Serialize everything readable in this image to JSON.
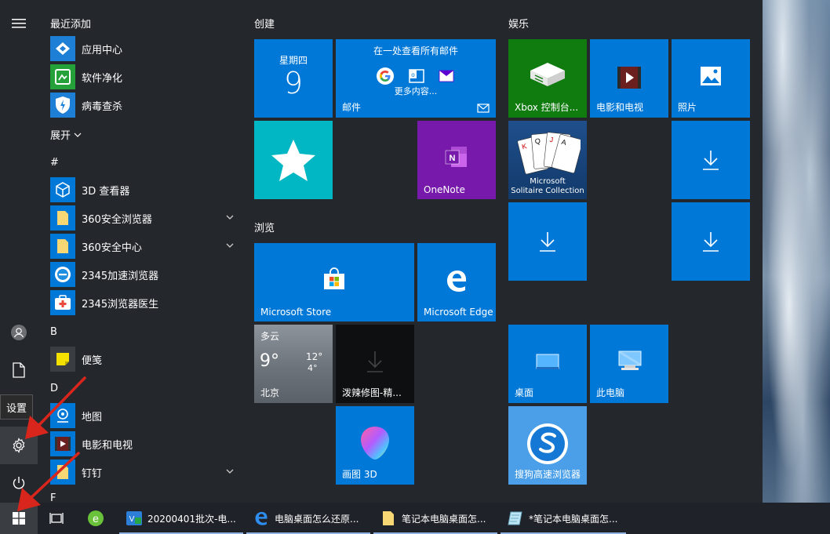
{
  "menu": {
    "recent_header": "最近添加",
    "recent_items": [
      {
        "label": "应用中心",
        "icon": "app-center-icon"
      },
      {
        "label": "软件净化",
        "icon": "software-clean-icon"
      },
      {
        "label": "病毒查杀",
        "icon": "virus-scan-icon"
      }
    ],
    "expand_label": "展开",
    "groups": [
      {
        "letter": "#",
        "items": [
          {
            "label": "3D 查看器",
            "icon": "3d-viewer-icon",
            "chevron": false
          },
          {
            "label": "360安全浏览器",
            "icon": "folder-icon",
            "chevron": true
          },
          {
            "label": "360安全中心",
            "icon": "folder-icon",
            "chevron": true
          },
          {
            "label": "2345加速浏览器",
            "icon": "2345-browser-icon",
            "chevron": false
          },
          {
            "label": "2345浏览器医生",
            "icon": "browser-doctor-icon",
            "chevron": false
          }
        ]
      },
      {
        "letter": "B",
        "items": [
          {
            "label": "便笺",
            "icon": "sticky-notes-icon",
            "chevron": false
          }
        ]
      },
      {
        "letter": "D",
        "items": [
          {
            "label": "地图",
            "icon": "maps-icon",
            "chevron": false
          },
          {
            "label": "电影和电视",
            "icon": "movies-tv-icon",
            "chevron": false
          },
          {
            "label": "钉钉",
            "icon": "folder-icon",
            "chevron": true
          }
        ]
      },
      {
        "letter": "F",
        "items": []
      }
    ],
    "rail_tooltip": "设置"
  },
  "tiles": {
    "section_create": "创建",
    "section_browse": "浏览",
    "section_play": "娱乐",
    "calendar_day": "星期四",
    "calendar_date": "9",
    "mail_heading": "在一处查看所有邮件",
    "mail_more": "更多内容...",
    "mail_label": "邮件",
    "onenote_label": "OneNote",
    "store_label": "Microsoft Store",
    "edge_label": "Microsoft Edge",
    "weather_condition": "多云",
    "weather_temp": "9°",
    "weather_high": "12°",
    "weather_low": "4°",
    "weather_city": "北京",
    "spicy_label": "泼辣修图-精...",
    "paint3d_label": "画图 3D",
    "xbox_label": "Xbox 控制台...",
    "movies_label": "电影和电视",
    "photos_label": "照片",
    "solitaire_line1": "Microsoft",
    "solitaire_line2": "Solitaire Collection",
    "desktop_label": "桌面",
    "thispc_label": "此电脑",
    "sogou_label": "搜狗高速浏览器"
  },
  "taskbar": {
    "apps": [
      {
        "label": "20200401批次-电...",
        "icon": "excel-like-icon"
      },
      {
        "label": "电脑桌面怎么还原...",
        "icon": "edge-icon"
      },
      {
        "label": "笔记本电脑桌面怎...",
        "icon": "folder-icon"
      },
      {
        "label": "*笔记本电脑桌面怎...",
        "icon": "notepad-icon"
      }
    ]
  },
  "colors": {
    "accent": "#0078d7",
    "teal": "#00b7c3",
    "onenote": "#7719aa",
    "xbox": "#107c10",
    "menu_bg": "#24272c",
    "arrow": "#d9261c"
  }
}
